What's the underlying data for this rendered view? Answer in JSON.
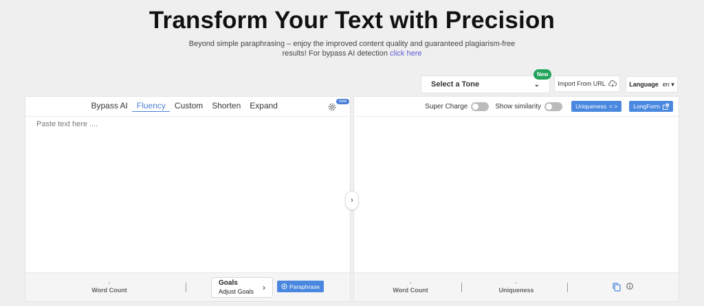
{
  "hero": {
    "title": "Transform Your Text with Precision",
    "subtitle_line1": "Beyond simple paraphrasing – enjoy the improved content quality and guaranteed plagiarism-free",
    "subtitle_line2": "results! For bypass AI detection",
    "subtitle_link": "click here"
  },
  "toolbar": {
    "tone_placeholder": "Select a Tone",
    "new_badge": "New",
    "import_label": "Import From URL",
    "language_label": "Language",
    "language_value": "en"
  },
  "left": {
    "tabs": [
      "Bypass AI",
      "Fluency",
      "Custom",
      "Shorten",
      "Expand"
    ],
    "active_tab": "Fluency",
    "settings_badge": "new",
    "placeholder": "Paste text here ....",
    "word_count_value": "-",
    "word_count_label": "Word Count",
    "goals_title": "Goals",
    "goals_sub": "Adjust Goals",
    "paraphrase_label": "Paraphrase"
  },
  "right": {
    "super_charge_label": "Super Charge",
    "show_similarity_label": "Show similarity",
    "uniqueness_btn": "Uniqueness",
    "longform_btn": "LongForm",
    "word_count_value": "-",
    "word_count_label": "Word Count",
    "uniqueness_value": "-",
    "uniqueness_label": "Uniqueness"
  },
  "colors": {
    "accent": "#4a88df",
    "badge_green": "#22a35a",
    "link": "#5b5bd6"
  }
}
